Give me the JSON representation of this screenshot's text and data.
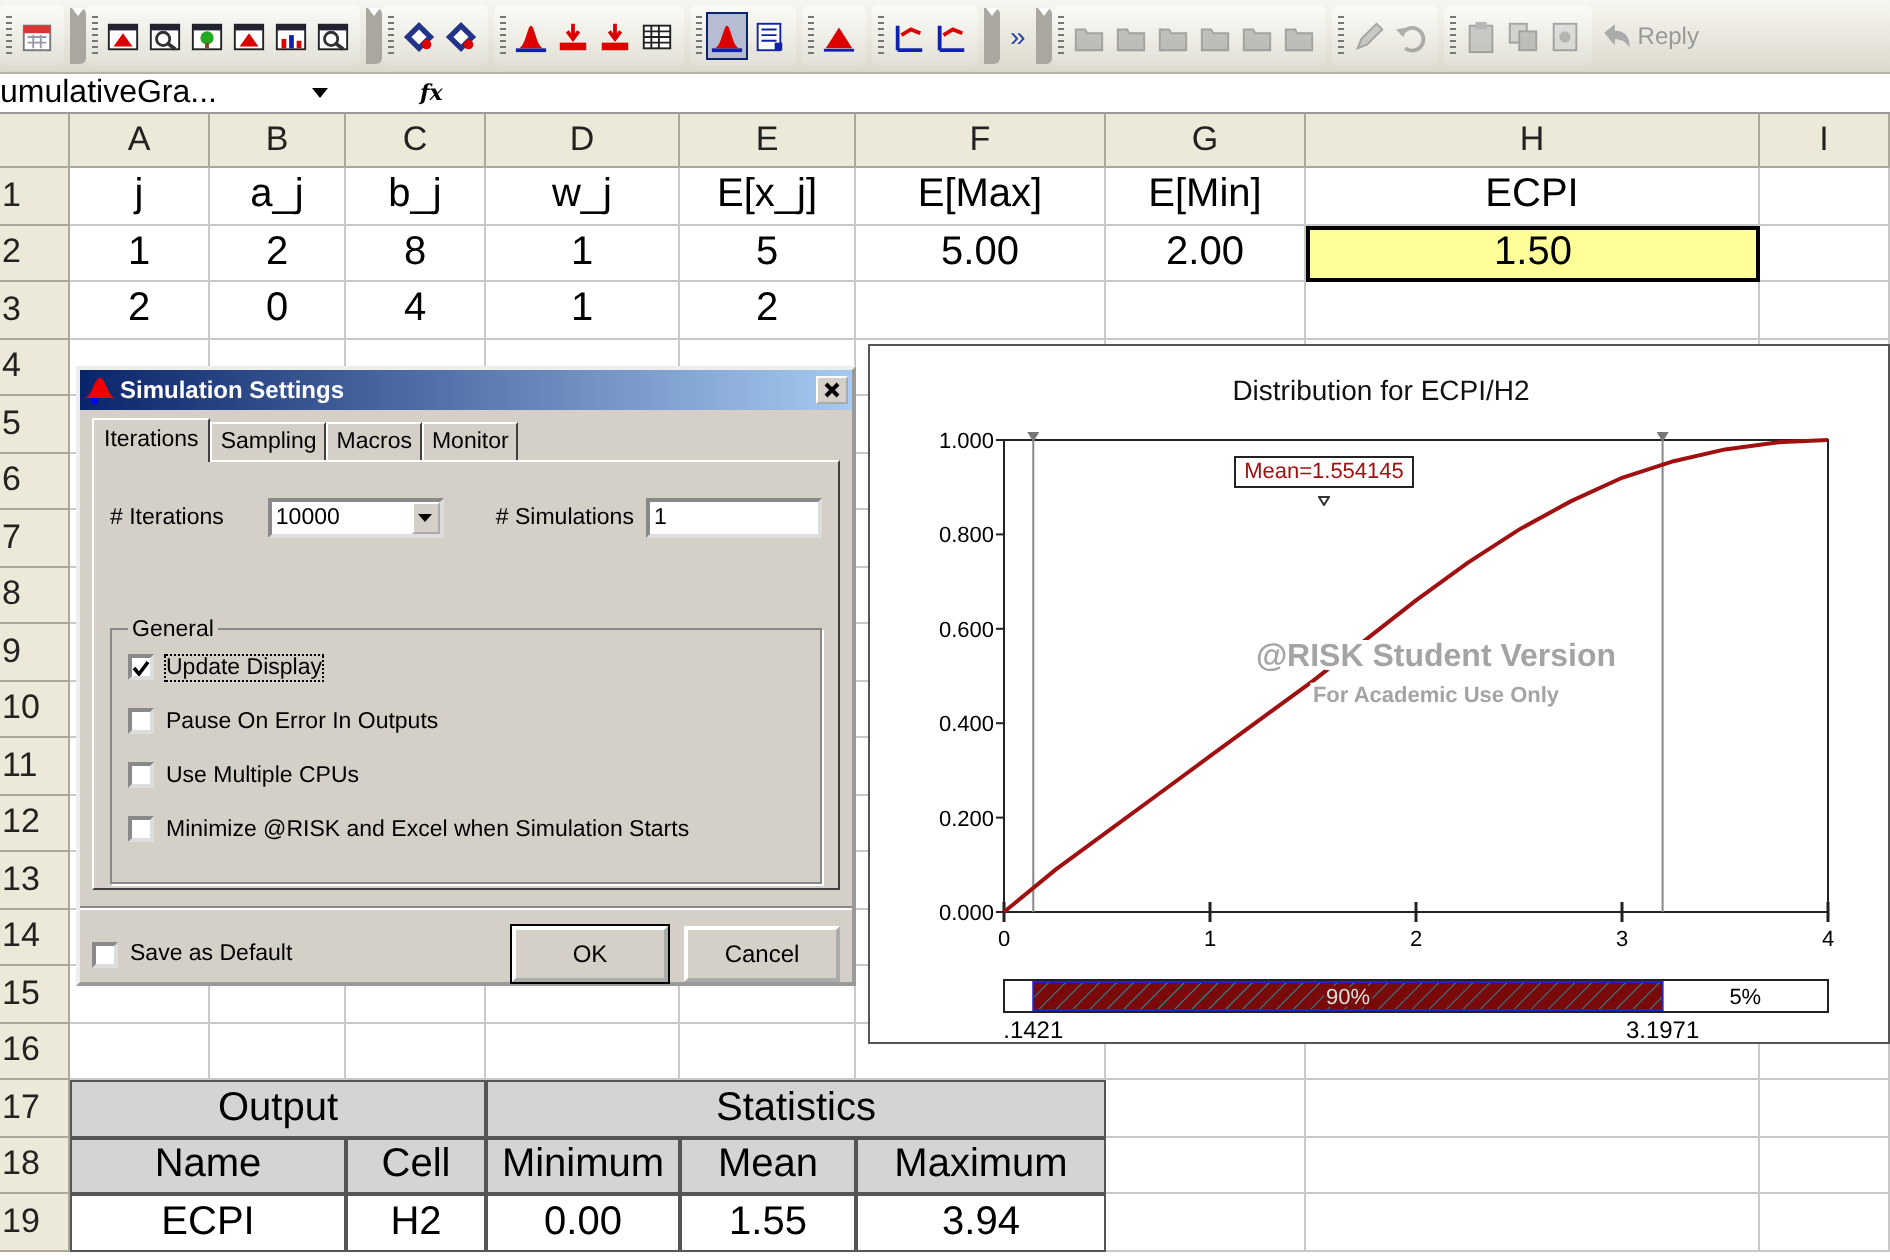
{
  "toolbar": {
    "groups": [
      {
        "items": [
          {
            "selected": false,
            "disabled": false
          }
        ]
      },
      {
        "items": [
          {
            "selected": false,
            "disabled": false
          },
          {
            "selected": false,
            "disabled": false
          },
          {
            "selected": false,
            "disabled": false
          },
          {
            "selected": false,
            "disabled": false
          },
          {
            "selected": false,
            "disabled": false
          },
          {
            "selected": false,
            "disabled": false
          }
        ]
      },
      {
        "items": [
          {
            "selected": false,
            "disabled": false
          },
          {
            "selected": false,
            "disabled": false
          }
        ]
      },
      {
        "items": [
          {
            "selected": false,
            "disabled": false
          },
          {
            "selected": false,
            "disabled": false
          },
          {
            "selected": false,
            "disabled": false
          },
          {
            "selected": false,
            "disabled": false
          }
        ]
      },
      {
        "items": [
          {
            "selected": true,
            "disabled": false
          },
          {
            "selected": false,
            "disabled": false
          }
        ]
      },
      {
        "items": [
          {
            "selected": false,
            "disabled": false
          }
        ]
      },
      {
        "items": [
          {
            "selected": false,
            "disabled": false
          },
          {
            "selected": false,
            "disabled": false
          }
        ]
      },
      {
        "overflow": "»"
      },
      {
        "items": [
          {
            "selected": false,
            "disabled": true
          },
          {
            "selected": false,
            "disabled": true
          },
          {
            "selected": false,
            "disabled": true
          },
          {
            "selected": false,
            "disabled": true
          },
          {
            "selected": false,
            "disabled": true
          },
          {
            "selected": false,
            "disabled": true
          }
        ]
      },
      {
        "items": [
          {
            "selected": false,
            "disabled": true
          },
          {
            "selected": false,
            "disabled": true
          }
        ]
      },
      {
        "items": [
          {
            "selected": false,
            "disabled": true
          },
          {
            "selected": false,
            "disabled": true
          },
          {
            "selected": false,
            "disabled": true
          }
        ]
      }
    ],
    "reply": {
      "label": "Reply",
      "disabled": true
    }
  },
  "formula_bar": {
    "name_box": "umulativeGra...",
    "fx": "fx"
  },
  "sheet": {
    "columns": [
      "A",
      "B",
      "C",
      "D",
      "E",
      "F",
      "G",
      "H",
      "I"
    ],
    "rows": [
      {
        "number": "1",
        "cells": [
          {
            "text": "j",
            "selected": false
          },
          {
            "text": "a_j",
            "selected": false
          },
          {
            "text": "b_j",
            "selected": false
          },
          {
            "text": "w_j",
            "selected": false
          },
          {
            "text": "E[x_j]",
            "selected": false
          },
          {
            "text": "E[Max]",
            "selected": false
          },
          {
            "text": "E[Min]",
            "selected": false
          },
          {
            "text": "ECPI",
            "selected": false
          }
        ]
      },
      {
        "number": "2",
        "cells": [
          {
            "text": "1",
            "selected": false
          },
          {
            "text": "2",
            "selected": false
          },
          {
            "text": "8",
            "selected": false
          },
          {
            "text": "1",
            "selected": false
          },
          {
            "text": "5",
            "selected": false
          },
          {
            "text": "5.00",
            "selected": false
          },
          {
            "text": "2.00",
            "selected": false
          },
          {
            "text": "1.50",
            "selected": true
          }
        ]
      },
      {
        "number": "3",
        "cells": [
          {
            "text": "2",
            "selected": false
          },
          {
            "text": "0",
            "selected": false
          },
          {
            "text": "4",
            "selected": false
          },
          {
            "text": "1",
            "selected": false
          },
          {
            "text": "2",
            "selected": false
          }
        ]
      },
      {
        "number": "4"
      },
      {
        "number": "5"
      },
      {
        "number": "6"
      },
      {
        "number": "7"
      },
      {
        "number": "8"
      },
      {
        "number": "9"
      },
      {
        "number": "10"
      },
      {
        "number": "11"
      },
      {
        "number": "12"
      },
      {
        "number": "13"
      },
      {
        "number": "14"
      },
      {
        "number": "15"
      },
      {
        "number": "16"
      },
      {
        "number": "17"
      },
      {
        "number": "18"
      },
      {
        "number": "19"
      }
    ],
    "output_table": {
      "groups": [
        "Output",
        "Statistics"
      ],
      "columns": [
        "Name",
        "Cell",
        "Minimum",
        "Mean",
        "Maximum"
      ],
      "rows": [
        [
          "ECPI",
          "H2",
          "0.00",
          "1.55",
          "3.94"
        ]
      ]
    }
  },
  "dialog": {
    "title": "Simulation Settings",
    "tabs": [
      {
        "label": "Iterations",
        "selected": true
      },
      {
        "label": "Sampling",
        "selected": false
      },
      {
        "label": "Macros",
        "selected": false
      },
      {
        "label": "Monitor",
        "selected": false
      }
    ],
    "fields": [
      {
        "kind": "dropdown",
        "label": "# Iterations",
        "value": "10000"
      },
      {
        "kind": "text",
        "label": "# Simulations",
        "value": "1"
      }
    ],
    "group": {
      "title": "General",
      "options": [
        {
          "label": "Update Display",
          "checked": true,
          "focused": true
        },
        {
          "label": "Pause On Error In Outputs",
          "checked": false,
          "focused": false
        },
        {
          "label": "Use Multiple CPUs",
          "checked": false,
          "focused": false
        },
        {
          "label": "Minimize @RISK and Excel when Simulation Starts",
          "checked": false,
          "focused": false
        }
      ]
    },
    "save_default": {
      "label": "Save as Default",
      "checked": false
    },
    "buttons": [
      {
        "label": "OK",
        "default": true
      },
      {
        "label": "Cancel",
        "default": false
      }
    ]
  },
  "chart_panel": {
    "watermark": [
      "@RISK Student Version",
      "For Academic Use Only"
    ],
    "range_bar": {
      "middle_label": "90%",
      "right_label": "5%",
      "bound_labels": [
        ".1421",
        "3.1971"
      ]
    },
    "chart_data": {
      "type": "line",
      "title": "Distribution for ECPI/H2",
      "x": [
        0,
        0.25,
        0.5,
        0.75,
        1,
        1.25,
        1.5,
        1.75,
        2,
        2.25,
        2.5,
        2.75,
        3,
        3.25,
        3.5,
        3.75,
        4
      ],
      "series": [
        {
          "color": "#a01010",
          "values": [
            0,
            0.09,
            0.17,
            0.25,
            0.33,
            0.41,
            0.49,
            0.575,
            0.66,
            0.74,
            0.81,
            0.87,
            0.92,
            0.955,
            0.98,
            0.995,
            1.0
          ]
        }
      ],
      "xlim": [
        0,
        4
      ],
      "ylim": [
        0,
        1
      ],
      "xticks": [
        0,
        1,
        2,
        3,
        4
      ],
      "yticks": [
        {
          "value": 0,
          "label": "0.000"
        },
        {
          "value": 0.2,
          "label": "0.200"
        },
        {
          "value": 0.4,
          "label": "0.400"
        },
        {
          "value": 0.6,
          "label": "0.600"
        },
        {
          "value": 0.8,
          "label": "0.800"
        },
        {
          "value": 1,
          "label": "1.000"
        }
      ],
      "ref_lines": [
        {
          "axis": "x",
          "value": 0.1421
        },
        {
          "axis": "x",
          "value": 3.1971
        }
      ],
      "annotations": [
        "Mean=1.554145"
      ]
    }
  }
}
